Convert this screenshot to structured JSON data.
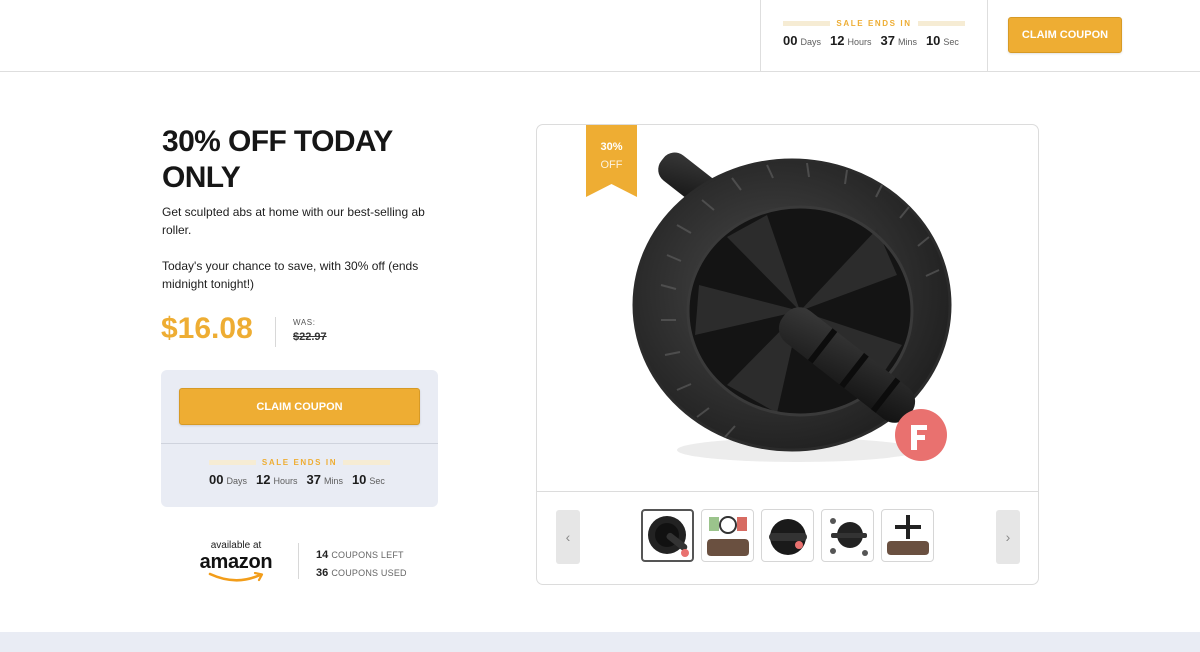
{
  "colors": {
    "accent": "#eead33",
    "panel": "#e9ecf4"
  },
  "header": {
    "sale_ends_label": "SALE ENDS IN",
    "countdown": {
      "days": "00",
      "days_unit": "Days",
      "hours": "12",
      "hours_unit": "Hours",
      "mins": "37",
      "mins_unit": "Mins",
      "secs": "10",
      "secs_unit": "Sec"
    },
    "claim_label": "CLAIM COUPON"
  },
  "offer": {
    "headline": "30% OFF TODAY ONLY",
    "description_1": "Get sculpted abs at home with our best-selling ab roller.",
    "description_2": "Today's your chance to save, with 30% off (ends midnight tonight!)",
    "price": "$16.08",
    "was_label": "WAS:",
    "was_price": "$22.97"
  },
  "coupon_box": {
    "claim_label": "CLAIM COUPON",
    "sale_ends_label": "SALE ENDS IN",
    "countdown": {
      "days": "00",
      "days_unit": "Days",
      "hours": "12",
      "hours_unit": "Hours",
      "mins": "37",
      "mins_unit": "Mins",
      "secs": "10",
      "secs_unit": "Sec"
    }
  },
  "retailer": {
    "available_label": "available at",
    "name": "amazon",
    "coupons_left": "14",
    "coupons_left_label": "COUPONS LEFT",
    "coupons_used": "36",
    "coupons_used_label": "COUPONS USED"
  },
  "product_card": {
    "badge_percent": "30%",
    "badge_off": "OFF",
    "prev_icon": "chevron-left-icon",
    "next_icon": "chevron-right-icon",
    "prev_glyph": "‹",
    "next_glyph": "›",
    "thumbnail_count": 5,
    "active_thumbnail": 1
  }
}
